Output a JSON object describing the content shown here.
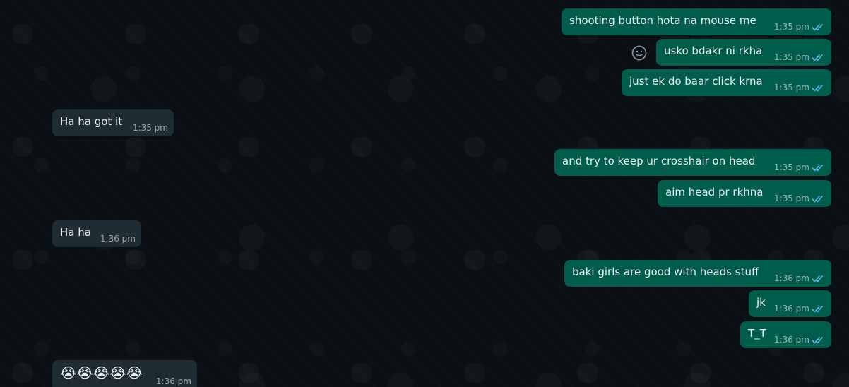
{
  "chat": {
    "messages": [
      {
        "text": "shooting button hota na mouse me",
        "time": "1:35 pm",
        "direction": "outgoing",
        "status": "read"
      },
      {
        "text": "usko bdakr ni rkha",
        "time": "1:35 pm",
        "direction": "outgoing",
        "status": "read"
      },
      {
        "text": "just ek do baar click krna",
        "time": "1:35 pm",
        "direction": "outgoing",
        "status": "read"
      },
      {
        "text": "Ha ha got it",
        "time": "1:35 pm",
        "direction": "incoming"
      },
      {
        "text": "and try to keep ur crosshair  on head",
        "time": "1:35 pm",
        "direction": "outgoing",
        "status": "read"
      },
      {
        "text": "aim head pr rkhna",
        "time": "1:35 pm",
        "direction": "outgoing",
        "status": "read"
      },
      {
        "text": "Ha ha",
        "time": "1:36 pm",
        "direction": "incoming"
      },
      {
        "text": "baki girls are good with heads stuff",
        "time": "1:36 pm",
        "direction": "outgoing",
        "status": "read"
      },
      {
        "text": "jk",
        "time": "1:36 pm",
        "direction": "outgoing",
        "status": "read"
      },
      {
        "text": "T_T",
        "time": "1:36 pm",
        "direction": "outgoing",
        "status": "read"
      },
      {
        "text": "😭😭😭😭😭",
        "time": "1:36 pm",
        "direction": "incoming"
      }
    ]
  },
  "colors": {
    "outgoing_bubble": "#005c4b",
    "incoming_bubble": "#202c33",
    "read_ticks": "#53bdeb",
    "background": "#0b1014"
  },
  "icons": {
    "reaction": "emoji-reaction-icon",
    "read_status": "double-check-icon"
  }
}
